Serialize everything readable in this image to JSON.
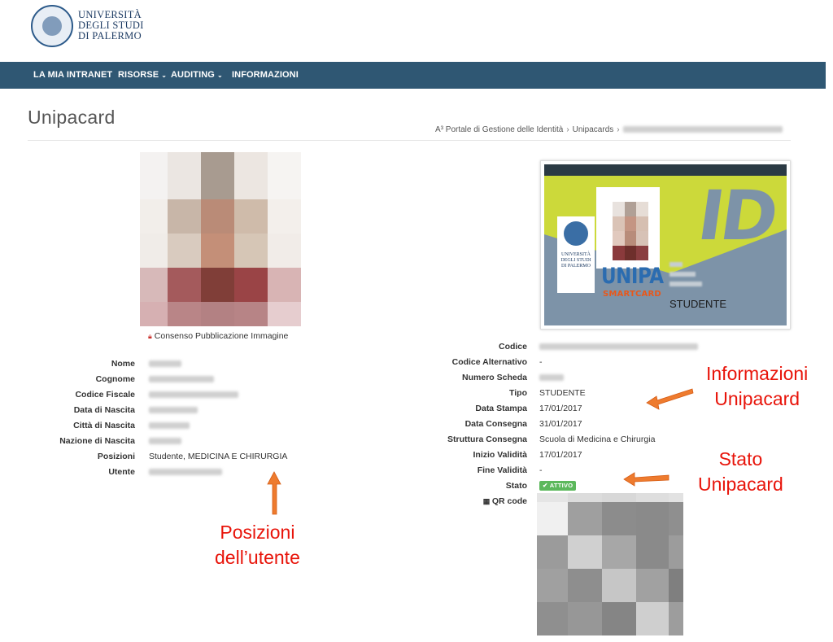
{
  "header": {
    "logo_lines": [
      "UNIVERSITÀ",
      "DEGLI STUDI",
      "DI PALERMO"
    ]
  },
  "nav": {
    "items": [
      {
        "label": "LA MIA INTRANET",
        "has_caret": false
      },
      {
        "label": "RISORSE",
        "has_caret": true
      },
      {
        "label": "AUDITING",
        "has_caret": true
      },
      {
        "label": "INFORMAZIONI",
        "has_caret": false
      }
    ],
    "caret": "⌄"
  },
  "page": {
    "title": "Unipacard",
    "breadcrumb": [
      "A³ Portale di Gestione delle Identità",
      "Unipacards"
    ],
    "breadcrumb_sep": "›"
  },
  "photo": {
    "consent_label": "Consenso Pubblicazione Immagine",
    "mosaic_colors": [
      "#f4f2f1",
      "#ebe6e2",
      "#a89b90",
      "#ece6e1",
      "#f6f4f2",
      "#f2eeea",
      "#c8b6a8",
      "#ba8b77",
      "#cfbbaa",
      "#f3efeb",
      "#f0ece8",
      "#d9cbbf",
      "#c48f78",
      "#d6c6b6",
      "#f1ece8",
      "#d7b9b9",
      "#a45a5c",
      "#803e38",
      "#9a4446",
      "#d8b4b4",
      "#d6b0b2",
      "#b98587",
      "#b38183",
      "#b78486",
      "#e6cdcf"
    ]
  },
  "personal": {
    "fields": [
      {
        "label": "Nome",
        "value": ""
      },
      {
        "label": "Cognome",
        "value": ""
      },
      {
        "label": "Codice Fiscale",
        "value": ""
      },
      {
        "label": "Data di Nascita",
        "value": ""
      },
      {
        "label": "Città di Nascita",
        "value": ""
      },
      {
        "label": "Nazione di Nascita",
        "value": ""
      },
      {
        "label": "Posizioni",
        "value": "Studente, MEDICINA E CHIRURGIA"
      },
      {
        "label": "Utente",
        "value": ""
      }
    ]
  },
  "card_image": {
    "logo_lines": [
      "UNIVERSITÀ",
      "DEGLI STUDI",
      "DI PALERMO"
    ],
    "brand": "UNIPA",
    "product": "SMARTCARD",
    "id_text": "ID",
    "type": "STUDENTE"
  },
  "card_info": {
    "fields": [
      {
        "label": "Codice",
        "value": ""
      },
      {
        "label": "Codice Alternativo",
        "value": "-"
      },
      {
        "label": "Numero Scheda",
        "value": ""
      },
      {
        "label": "Tipo",
        "value": "STUDENTE"
      },
      {
        "label": "Data Stampa",
        "value": "17/01/2017"
      },
      {
        "label": "Data Consegna",
        "value": "31/01/2017"
      },
      {
        "label": "Struttura Consegna",
        "value": "Scuola di Medicina e Chirurgia"
      },
      {
        "label": "Inizio Validità",
        "value": "17/01/2017"
      },
      {
        "label": "Fine Validità",
        "value": "-"
      },
      {
        "label": "Stato",
        "value": ""
      },
      {
        "label": "QR code",
        "value": ""
      }
    ],
    "status_badge": "✔ ATTIVO",
    "qr_colors": [
      "#e5e5e5",
      "#dcdcdc",
      "#d8d8d8",
      "#dedede",
      "#e2e2e2",
      "#f0f0f0",
      "#9f9f9f",
      "#8c8c8c",
      "#8a8a8a",
      "#8f8f8f",
      "#9b9b9b",
      "#d0d0d0",
      "#a7a7a7",
      "#8a8a8a",
      "#9c9c9c",
      "#a0a0a0",
      "#8e8e8e",
      "#c6c6c6",
      "#a1a1a1",
      "#7f7f7f",
      "#8f8f8f",
      "#979797",
      "#858585",
      "#cfcfcf",
      "#9d9d9d",
      "#919191",
      "#8d8d8d",
      "#878787",
      "#767676",
      "#d2d2d2"
    ]
  },
  "annotations": {
    "info": [
      "Informazioni",
      "Unipacard"
    ],
    "stato": [
      "Stato",
      "Unipacard"
    ],
    "posizioni": [
      "Posizioni",
      "dell’utente"
    ]
  },
  "colors": {
    "navbar": "#2f5773",
    "annotation": "#e8140a",
    "arrow": "#ee7b2e",
    "badge": "#5cb85c"
  }
}
